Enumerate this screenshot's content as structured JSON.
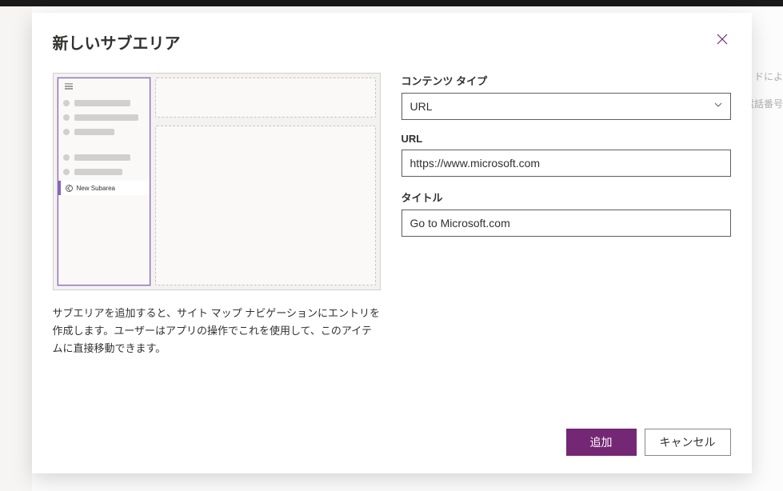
{
  "modal": {
    "title": "新しいサブエリア",
    "preview_subarea_label": "New Subarea",
    "help_text": "サブエリアを追加すると、サイト マップ ナビゲーションにエントリを作成します。ユーザーはアプリの操作でこれを使用して、このアイテムに直接移動できます。"
  },
  "form": {
    "content_type": {
      "label": "コンテンツ タイプ",
      "value": "URL"
    },
    "url": {
      "label": "URL",
      "value": "https://www.microsoft.com"
    },
    "title": {
      "label": "タイトル",
      "value": "Go to Microsoft.com"
    }
  },
  "buttons": {
    "add": "追加",
    "cancel": "キャンセル"
  },
  "background": {
    "hint1": "ドによ",
    "hint2": "電話番号"
  }
}
